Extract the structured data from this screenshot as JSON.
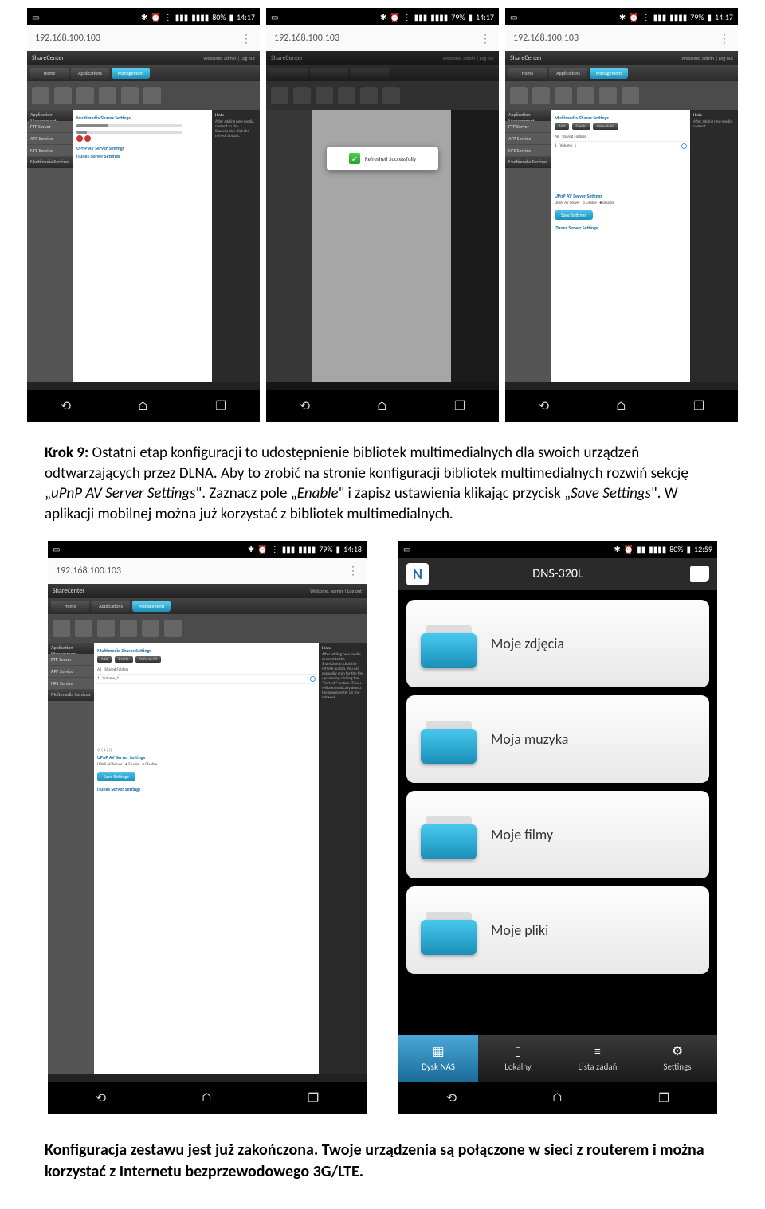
{
  "status_bar": {
    "battery1": "80%",
    "battery2": "79%",
    "battery3": "79%",
    "battery4": "79%",
    "battery5": "80%",
    "time1": "14:17",
    "time2": "14:17",
    "time3": "14:17",
    "time4": "14:18",
    "time5": "12:59"
  },
  "browser": {
    "url": "192.168.100.103"
  },
  "sharecenter": {
    "brand": "ShareCenter",
    "user_text": "Welcome, admin | Log out",
    "tabs": {
      "home": "Home",
      "apps": "Applications",
      "mgmt": "Management"
    },
    "sidebar_header": "Application Management",
    "sidebar_items": [
      "FTP Server",
      "AFP Service",
      "NFS Service"
    ],
    "sidebar_header2": "Multimedia Services",
    "section_title": "Multimedia Shares Settings",
    "section_upnp": "UPnP AV Server Settings",
    "section_itunes": "iTunes Server Settings",
    "upnp_label": "UPnP AV Server",
    "enable_label": "Enable",
    "disable_label": "Disable",
    "save_btn": "Save Settings",
    "modal_text": "Refreshed Successfully",
    "btn_add": "Add",
    "btn_delete": "Delete",
    "btn_refresh": "Refresh All",
    "col_all": "All",
    "col_shared": "Shared Folders",
    "vol": "Volume_1"
  },
  "step9": {
    "title": "Krok 9:",
    "body1": " Ostatni etap konfiguracji to udostępnienie bibliotek multimedialnych dla swoich urządzeń odtwarzających przez DLNA. Aby to zrobić na stronie konfiguracji bibliotek multimedialnych rozwiń sekcję „",
    "em1": "uPnP AV Server Settings",
    "body2": "\". Zaznacz pole „",
    "em2": "Enable",
    "body3": "\" i zapisz ustawienia klikając przycisk „",
    "em3": "Save Settings",
    "body4": "\". W aplikacji mobilnej można już korzystać z bibliotek multimedialnych."
  },
  "dns_app": {
    "title": "DNS-320L",
    "items": [
      "Moje zdjęcia",
      "Moja muzyka",
      "Moje filmy",
      "Moje pliki"
    ],
    "tabs": [
      "Dysk NAS",
      "Lokalny",
      "Lista zadań",
      "Settings"
    ]
  },
  "conclusion": "Konfiguracja zestawu jest już zakończona. Twoje urządzenia są połączone w sieci z routerem i można korzystać z Internetu bezprzewodowego 3G/LTE."
}
